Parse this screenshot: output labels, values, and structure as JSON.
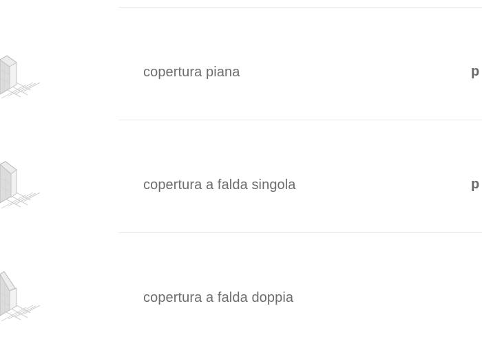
{
  "rows": [
    {
      "label": "copertura piana",
      "trailing": "p",
      "icon": "flat-roof-building-icon"
    },
    {
      "label": "copertura a falda singola",
      "trailing": "p",
      "icon": "single-pitch-roof-building-icon"
    },
    {
      "label": "copertura a falda doppia",
      "trailing": "",
      "icon": "double-pitch-roof-building-icon"
    }
  ],
  "colors": {
    "text": "#6d6d6d",
    "divider": "#e9e9e9",
    "icon_fill": "#e6e6e6",
    "icon_stroke": "#bcbcbc"
  }
}
